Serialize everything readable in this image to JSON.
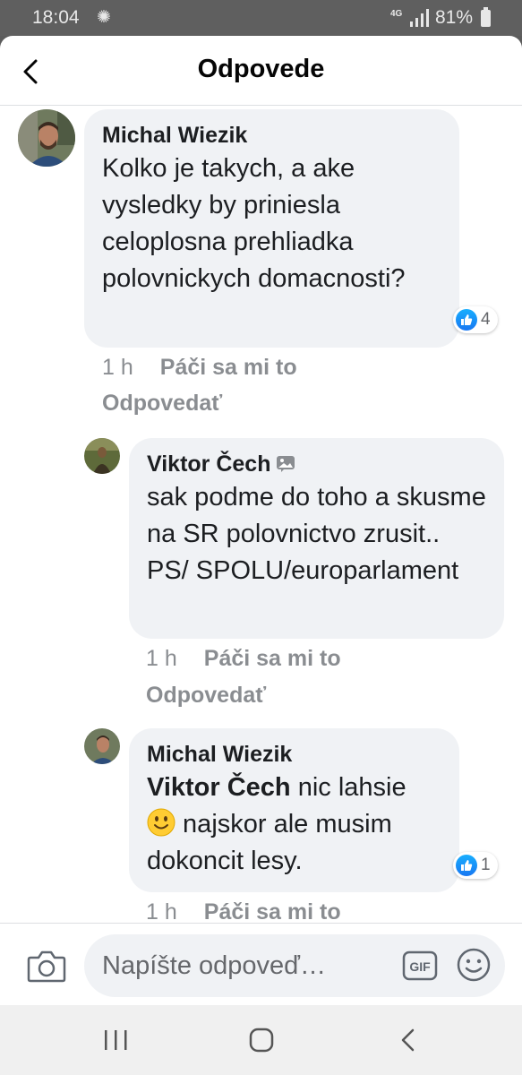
{
  "status_bar": {
    "time": "18:04",
    "network": "4G",
    "battery": "81%"
  },
  "header": {
    "title": "Odpovede"
  },
  "comments": [
    {
      "author": "Michal Wiezik",
      "text": "Kolko je takych, a ake vysledky by priniesla celoplosna prehliadka polovnickych domacnosti?",
      "time": "1 h",
      "like_label": "Páči sa mi to",
      "reply_label": "Odpovedať",
      "reaction_count": "4"
    },
    {
      "author": "Viktor Čech",
      "text": "sak podme do toho a skusme na SR polovnictvo zrusit.. PS/ SPOLU/europarlament",
      "time": "1 h",
      "like_label": "Páči sa mi to",
      "reply_label": "Odpovedať"
    },
    {
      "author": "Michal Wiezik",
      "mention": "Viktor Čech",
      "text_after_mention": " nic lahsie",
      "text_after_emoji": " najskor ale musim dokoncit lesy.",
      "time": "1 h",
      "like_label": "Páči sa mi to",
      "reaction_count": "1"
    }
  ],
  "composer": {
    "placeholder": "Napíšte odpoveď…",
    "gif_label": "GIF"
  },
  "colors": {
    "like_blue": "#1877f2",
    "bubble_bg": "#f0f2f5",
    "meta_gray": "#8a8d91",
    "status_bar_bg": "#5f5f5f"
  },
  "icons": [
    "back-arrow-icon",
    "camera-icon",
    "gif-icon",
    "emoji-icon",
    "like-icon",
    "comment-image-icon",
    "nav-recent-icon",
    "nav-home-icon",
    "nav-back-icon"
  ]
}
